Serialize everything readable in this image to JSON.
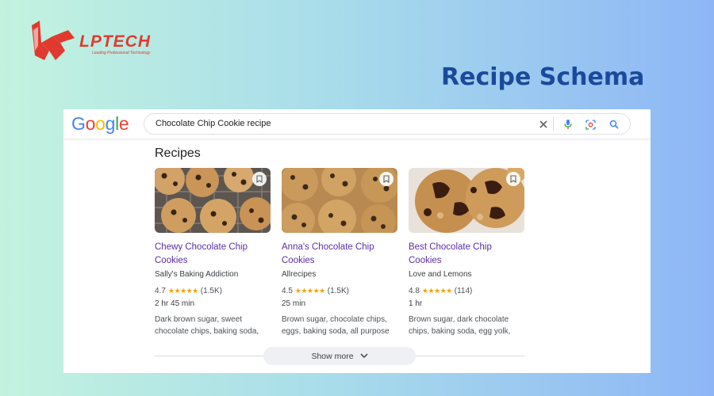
{
  "brand": {
    "name": "LPTECH",
    "tagline": "Leading Professional Technology",
    "color": "#e03a2f"
  },
  "headline": "Recipe Schema",
  "google": {
    "logo_letters": [
      {
        "ch": "G",
        "color": "#4285f4"
      },
      {
        "ch": "o",
        "color": "#ea4335"
      },
      {
        "ch": "o",
        "color": "#fbbc05"
      },
      {
        "ch": "g",
        "color": "#4285f4"
      },
      {
        "ch": "l",
        "color": "#34a853"
      },
      {
        "ch": "e",
        "color": "#ea4335"
      }
    ]
  },
  "search": {
    "query": "Chocolate Chip Cookie recipe",
    "icons": [
      "close-icon",
      "microphone-icon",
      "lens-icon",
      "search-icon"
    ]
  },
  "section_title": "Recipes",
  "recipes": [
    {
      "title": "Chewy Chocolate Chip Cookies",
      "source": "Sally's Baking Addiction",
      "rating": "4.7",
      "stars": "★★★★★",
      "rating_count": "(1.5K)",
      "time": "2 hr 45 min",
      "ingredients_line1": "Dark brown sugar, sweet",
      "ingredients_line2": "chocolate chips, baking soda,"
    },
    {
      "title": "Anna's Chocolate Chip Cookies",
      "source": "Allrecipes",
      "rating": "4.5",
      "stars": "★★★★★",
      "rating_count": "(1.5K)",
      "time": "25 min",
      "ingredients_line1": "Brown sugar, chocolate chips,",
      "ingredients_line2": "eggs, baking soda, all purpose"
    },
    {
      "title": "Best Chocolate Chip Cookies",
      "source": "Love and Lemons",
      "rating": "4.8",
      "stars": "★★★★★",
      "rating_count": "(114)",
      "time": "1 hr",
      "ingredients_line1": "Brown sugar, dark chocolate",
      "ingredients_line2": "chips, baking soda, egg yolk,"
    }
  ],
  "show_more": "Show more"
}
